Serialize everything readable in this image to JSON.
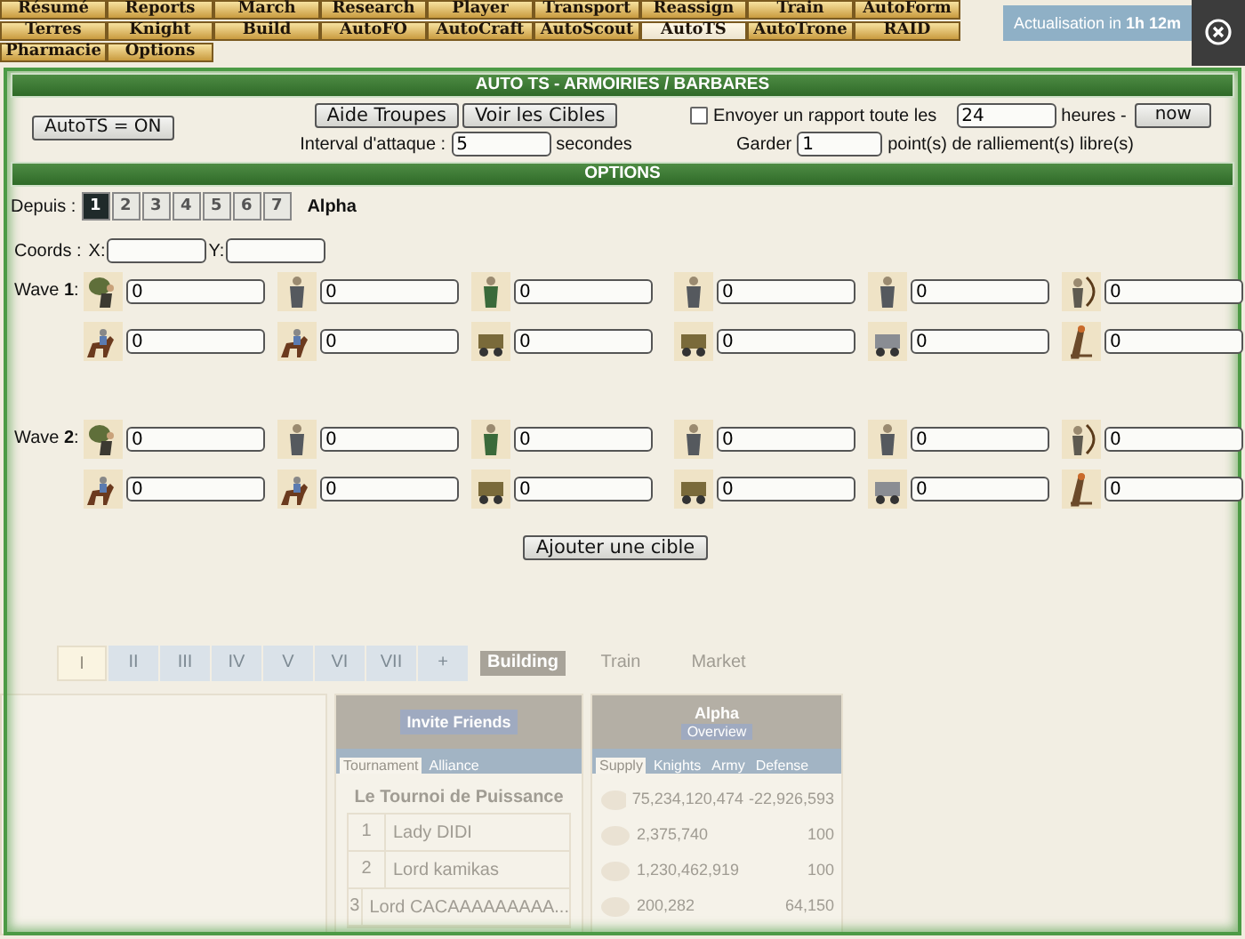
{
  "menu": {
    "rows": [
      [
        {
          "label": "Résumé",
          "selected": false
        },
        {
          "label": "Reports",
          "selected": false
        },
        {
          "label": "March",
          "selected": false
        },
        {
          "label": "Research",
          "selected": false
        },
        {
          "label": "Player",
          "selected": false
        },
        {
          "label": "Transport",
          "selected": false
        },
        {
          "label": "Reassign",
          "selected": false
        },
        {
          "label": "Train",
          "selected": false
        },
        {
          "label": "AutoForm",
          "selected": false
        }
      ],
      [
        {
          "label": "Terres",
          "selected": false
        },
        {
          "label": "Knight",
          "selected": false
        },
        {
          "label": "Build",
          "selected": false
        },
        {
          "label": "AutoFO",
          "selected": false
        },
        {
          "label": "AutoCraft",
          "selected": false
        },
        {
          "label": "AutoScout",
          "selected": false
        },
        {
          "label": "AutoTS",
          "selected": true
        },
        {
          "label": "AutoTrone",
          "selected": false
        },
        {
          "label": "RAID",
          "selected": false
        }
      ],
      [
        {
          "label": "Pharmacie",
          "selected": false
        },
        {
          "label": "Options",
          "selected": false
        }
      ]
    ]
  },
  "refresh_notice": "Actualisation in **1h 12m**",
  "dialog": {
    "title": "AUTO TS - ARMOIRIES / BARBARES",
    "toggle_button": "AutoTS = ON",
    "buttons": [
      "Aide Troupes",
      "Voir les Cibles"
    ],
    "interval": {
      "label": "Interval d'attaque :",
      "value": "5",
      "unit": "secondes"
    },
    "report": {
      "checked": false,
      "label": "Envoyer un rapport toute les",
      "value": "24",
      "unit": "heures -",
      "button": "now"
    },
    "keep": {
      "label": "Garder",
      "value": "1",
      "unit": "point(s) de ralliement(s) libre(s)"
    },
    "options_title": "OPTIONS",
    "from": {
      "label": "Depuis :",
      "cities": [
        {
          "label": "1",
          "selected": true
        },
        {
          "label": "2",
          "selected": false
        },
        {
          "label": "3",
          "selected": false
        },
        {
          "label": "4",
          "selected": false
        },
        {
          "label": "5",
          "selected": false
        },
        {
          "label": "6",
          "selected": false
        },
        {
          "label": "7",
          "selected": false
        }
      ],
      "city_name": "Alpha"
    },
    "coords": {
      "label": "Coords :",
      "x_label": "X:",
      "y_label": "Y:"
    },
    "waves": [
      {
        "label": "Wave **1**:",
        "values": [
          "0",
          "0",
          "0",
          "0",
          "0",
          "0",
          "0",
          "0",
          "0",
          "0",
          "0",
          "0"
        ]
      },
      {
        "label": "Wave **2**:",
        "values": [
          "0",
          "0",
          "0",
          "0",
          "0",
          "0",
          "0",
          "0",
          "0",
          "0",
          "0",
          "0"
        ]
      }
    ],
    "add_button": "Ajouter une cible"
  },
  "background": {
    "city_tabs": [
      {
        "label": "I",
        "selected": true
      },
      {
        "label": "II",
        "selected": false
      },
      {
        "label": "III",
        "selected": false
      },
      {
        "label": "IV",
        "selected": false
      },
      {
        "label": "V",
        "selected": false
      },
      {
        "label": "VI",
        "selected": false
      },
      {
        "label": "VII",
        "selected": false
      },
      {
        "label": "+",
        "selected": false
      }
    ],
    "view_tabs": [
      {
        "label": "Building",
        "selected": true
      },
      {
        "label": "Train",
        "selected": false
      },
      {
        "label": "Market",
        "selected": false
      }
    ],
    "tournament_panel": {
      "button": "Invite Friends",
      "tabs": [
        {
          "label": "Tournament",
          "selected": true
        },
        {
          "label": "Alliance",
          "selected": false
        }
      ],
      "title": "Le Tournoi de Puissance",
      "rows": [
        {
          "rank": "1",
          "name": "Lady DIDI"
        },
        {
          "rank": "2",
          "name": "Lord kamikas"
        },
        {
          "rank": "3",
          "name": "Lord CACAAAAAAAAA..."
        }
      ]
    },
    "city_panel": {
      "city": "Alpha",
      "button": "Overview",
      "tabs": [
        {
          "label": "Supply",
          "selected": true
        },
        {
          "label": "Knights",
          "selected": false
        },
        {
          "label": "Army",
          "selected": false
        },
        {
          "label": "Defense",
          "selected": false
        }
      ],
      "resources": [
        {
          "amount": "75,234,120,474",
          "rate": "-22,926,593"
        },
        {
          "amount": "2,375,740",
          "rate": "100"
        },
        {
          "amount": "1,230,462,919",
          "rate": "100"
        },
        {
          "amount": "200,282",
          "rate": "64,150"
        }
      ]
    }
  }
}
